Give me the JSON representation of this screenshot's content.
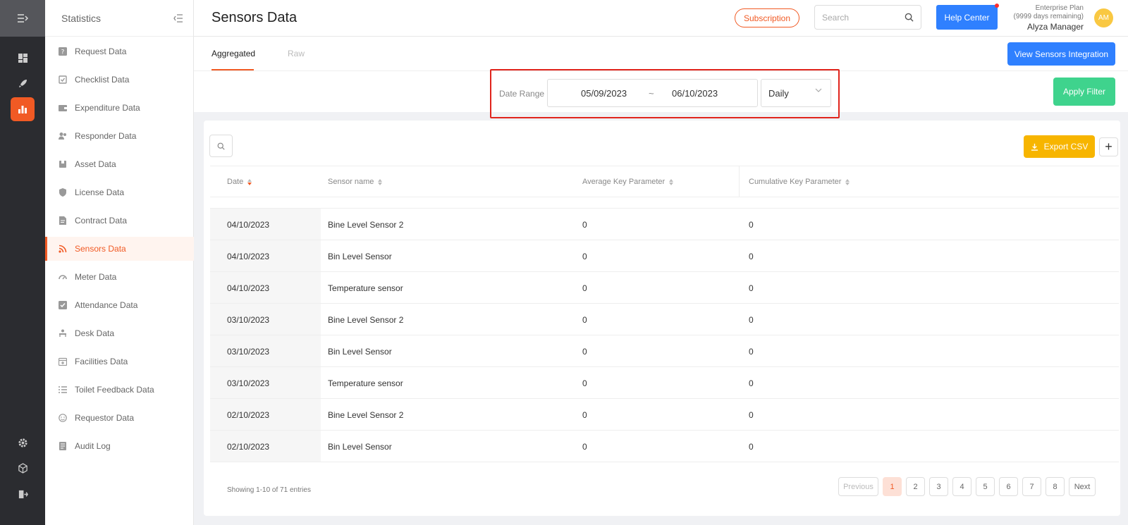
{
  "sidebar": {
    "title": "Statistics",
    "items": [
      {
        "label": "Request Data",
        "icon": "help-square-icon"
      },
      {
        "label": "Checklist Data",
        "icon": "checklist-icon"
      },
      {
        "label": "Expenditure Data",
        "icon": "wallet-icon"
      },
      {
        "label": "Responder Data",
        "icon": "people-icon"
      },
      {
        "label": "Asset Data",
        "icon": "box-icon"
      },
      {
        "label": "License Data",
        "icon": "shield-icon"
      },
      {
        "label": "Contract Data",
        "icon": "document-icon"
      },
      {
        "label": "Sensors Data",
        "icon": "rss-icon"
      },
      {
        "label": "Meter Data",
        "icon": "gauge-icon"
      },
      {
        "label": "Attendance Data",
        "icon": "check-square-icon"
      },
      {
        "label": "Desk Data",
        "icon": "desk-icon"
      },
      {
        "label": "Facilities Data",
        "icon": "calendar-icon"
      },
      {
        "label": "Toilet Feedback Data",
        "icon": "list-icon"
      },
      {
        "label": "Requestor Data",
        "icon": "smile-icon"
      },
      {
        "label": "Audit Log",
        "icon": "log-icon"
      }
    ],
    "active_index": 7
  },
  "header": {
    "title": "Sensors Data",
    "subscription_label": "Subscription",
    "search_placeholder": "Search",
    "help_label": "Help Center",
    "plan_name": "Enterprise Plan",
    "plan_days": "(9999 days remaining)",
    "user_name": "Alyza Manager",
    "avatar_initials": "AM"
  },
  "tabs": {
    "aggregated": "Aggregated",
    "raw": "Raw",
    "view_integration_label": "View Sensors Integration"
  },
  "filter": {
    "label": "Date Range",
    "start": "05/09/2023",
    "separator": "~",
    "end": "06/10/2023",
    "interval": "Daily",
    "apply_label": "Apply Filter"
  },
  "table": {
    "export_label": "Export CSV",
    "plus_label": "+",
    "columns": [
      "Date",
      "Sensor name",
      "Average Key Parameter",
      "Cumulative Key Parameter"
    ],
    "rows": [
      [
        "04/10/2023",
        "Bine Level Sensor 2",
        "0",
        "0"
      ],
      [
        "04/10/2023",
        "Bin Level Sensor",
        "0",
        "0"
      ],
      [
        "04/10/2023",
        "Temperature sensor",
        "0",
        "0"
      ],
      [
        "03/10/2023",
        "Bine Level Sensor 2",
        "0",
        "0"
      ],
      [
        "03/10/2023",
        "Bin Level Sensor",
        "0",
        "0"
      ],
      [
        "03/10/2023",
        "Temperature sensor",
        "0",
        "0"
      ],
      [
        "02/10/2023",
        "Bine Level Sensor 2",
        "0",
        "0"
      ],
      [
        "02/10/2023",
        "Bin Level Sensor",
        "0",
        "0"
      ]
    ],
    "showing": "Showing 1-10 of 71 entries"
  },
  "pagination": {
    "previous": "Previous",
    "next": "Next",
    "pages": [
      "1",
      "2",
      "3",
      "4",
      "5",
      "6",
      "7",
      "8"
    ],
    "current": "1"
  },
  "colors": {
    "accent": "#f15a24",
    "primary": "#2f80ff",
    "success": "#3fd38d",
    "warning": "#f7b500",
    "rail": "#2b2c30"
  }
}
